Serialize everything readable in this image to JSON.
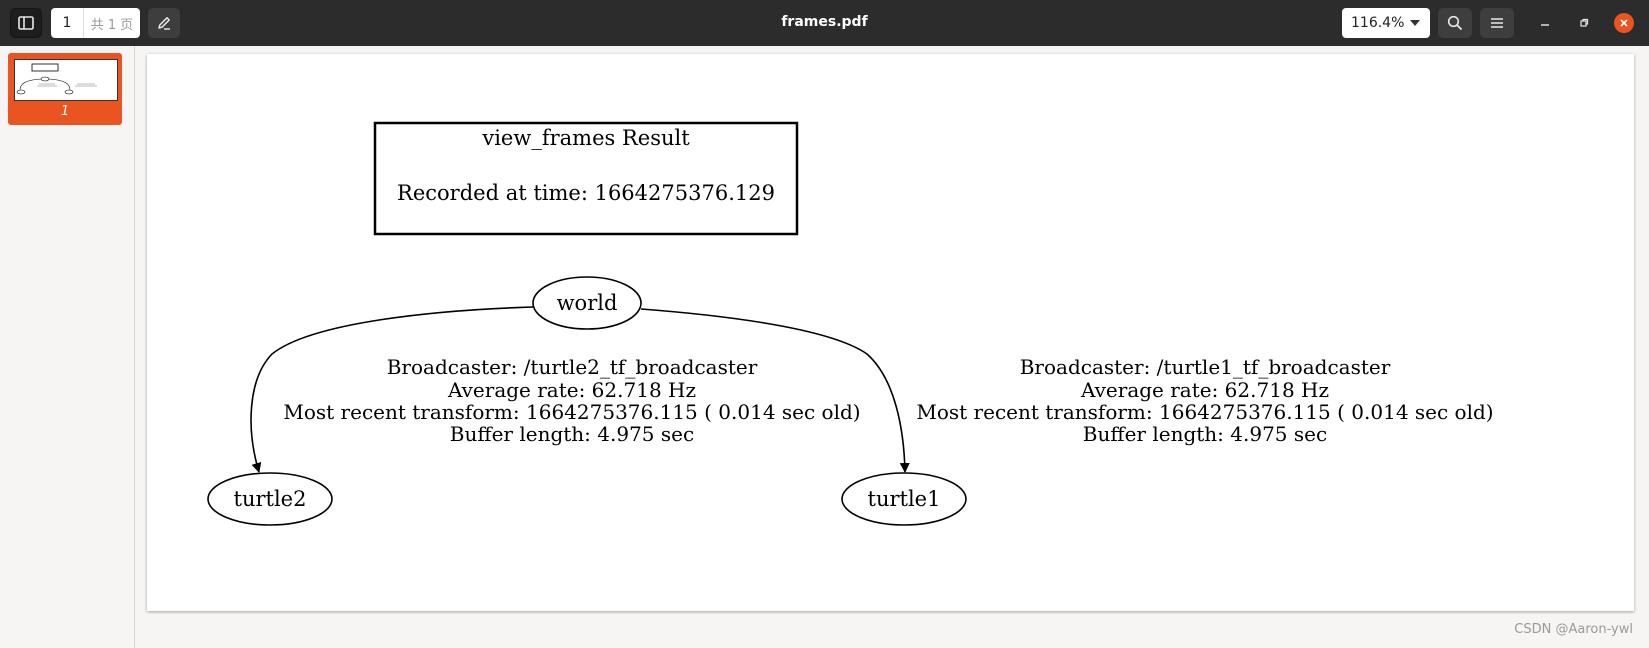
{
  "toolbar": {
    "page_current": "1",
    "page_count": "共 1 页",
    "title": "frames.pdf",
    "zoom": "116.4%"
  },
  "sidebar": {
    "thumbnails": [
      {
        "label": "1"
      }
    ]
  },
  "pdf": {
    "header_box": {
      "title": "view_frames Result",
      "recorded": "Recorded at time: 1664275376.129"
    },
    "nodes": {
      "world": "world",
      "turtle2": "turtle2",
      "turtle1": "turtle1"
    },
    "edge_turtle2": {
      "broadcaster": "Broadcaster: /turtle2_tf_broadcaster",
      "rate": "Average rate: 62.718 Hz",
      "recent": "Most recent transform: 1664275376.115 ( 0.014 sec old)",
      "buffer": "Buffer length: 4.975 sec"
    },
    "edge_turtle1": {
      "broadcaster": "Broadcaster: /turtle1_tf_broadcaster",
      "rate": "Average rate: 62.718 Hz",
      "recent": "Most recent transform: 1664275376.115 ( 0.014 sec old)",
      "buffer": "Buffer length: 4.975 sec"
    }
  },
  "watermark": "CSDN @Aaron-ywl",
  "colors": {
    "accent": "#e95420",
    "headerbar": "#2c2c2c"
  },
  "icons": [
    "sidebar-toggle-icon",
    "pencil-icon",
    "chevron-down-icon",
    "search-icon",
    "hamburger-menu-icon",
    "minimize-icon",
    "maximize-icon",
    "close-icon"
  ]
}
